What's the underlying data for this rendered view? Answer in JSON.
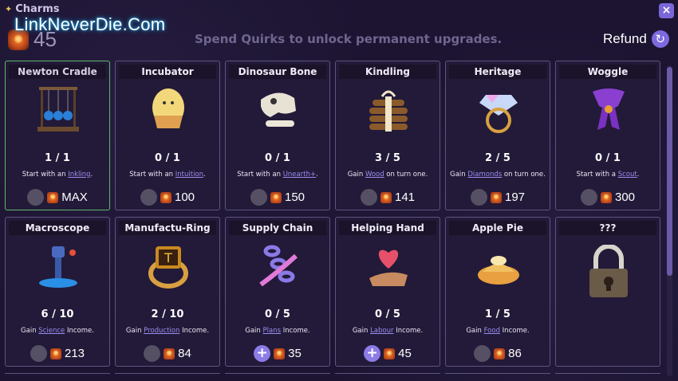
{
  "header": {
    "title": "Charms",
    "close_label": "×",
    "quirks_count": "45",
    "subtitle": "Spend Quirks to unlock permanent upgrades.",
    "refund_label": "Refund",
    "watermark": "LinkNeverDie.Com"
  },
  "cards": [
    {
      "name": "Newton Cradle",
      "progress": "1 / 1",
      "desc_pre": "Start with an ",
      "desc_link": "Inkling",
      "desc_post": ".",
      "cost": "MAX",
      "button": "none",
      "owned": true
    },
    {
      "name": "Incubator",
      "progress": "0 / 1",
      "desc_pre": "Start with an ",
      "desc_link": "Intuition",
      "desc_post": ".",
      "cost": "100",
      "button": "none"
    },
    {
      "name": "Dinosaur Bone",
      "progress": "0 / 1",
      "desc_pre": "Start with an ",
      "desc_link": "Unearth+",
      "desc_post": ".",
      "cost": "150",
      "button": "none"
    },
    {
      "name": "Kindling",
      "progress": "3 / 5",
      "desc_pre": "Gain ",
      "desc_link": "Wood",
      "desc_post": " on turn one.",
      "cost": "141",
      "button": "none"
    },
    {
      "name": "Heritage",
      "progress": "2 / 5",
      "desc_pre": "Gain ",
      "desc_link": "Diamonds",
      "desc_post": " on turn one.",
      "cost": "197",
      "button": "none"
    },
    {
      "name": "Woggle",
      "progress": "0 / 1",
      "desc_pre": "Start with a ",
      "desc_link": "Scout",
      "desc_post": ".",
      "cost": "300",
      "button": "none"
    },
    {
      "name": "Macroscope",
      "progress": "6 / 10",
      "desc_pre": "Gain ",
      "desc_link": "Science",
      "desc_post": " Income.",
      "cost": "213",
      "button": "none"
    },
    {
      "name": "Manufactu-Ring",
      "progress": "2 / 10",
      "desc_pre": "Gain ",
      "desc_link": "Production",
      "desc_post": " Income.",
      "cost": "84",
      "button": "none"
    },
    {
      "name": "Supply Chain",
      "progress": "0 / 5",
      "desc_pre": "Gain ",
      "desc_link": "Plans",
      "desc_post": " Income.",
      "cost": "35",
      "button": "plus"
    },
    {
      "name": "Helping Hand",
      "progress": "0 / 5",
      "desc_pre": "Gain ",
      "desc_link": "Labour",
      "desc_post": " Income.",
      "cost": "45",
      "button": "plus"
    },
    {
      "name": "Apple Pie",
      "progress": "1 / 5",
      "desc_pre": "Gain ",
      "desc_link": "Food",
      "desc_post": " Income.",
      "cost": "86",
      "button": "none"
    },
    {
      "name": "???",
      "locked": true
    }
  ],
  "colors": {
    "accent": "#7d6ae0",
    "owned_border": "#5db86a",
    "link": "#9c8df0"
  },
  "icons": [
    "sparkle-icon",
    "close-icon",
    "quirk-icon",
    "refund-icon",
    "plus-icon",
    "lock-icon"
  ]
}
